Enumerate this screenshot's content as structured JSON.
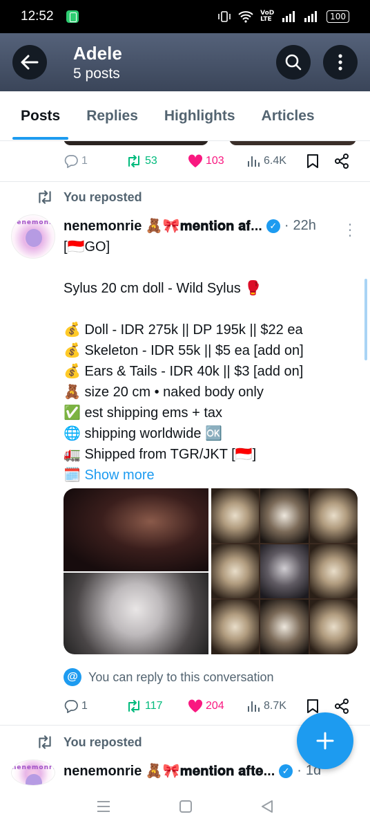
{
  "status_bar": {
    "time": "12:52",
    "battery": "100",
    "network": "VoD LTE"
  },
  "header": {
    "title": "Adele",
    "subtitle": "5 posts"
  },
  "tabs": [
    "Posts",
    "Replies",
    "Highlights",
    "Articles"
  ],
  "tabs_active": "Posts",
  "colors": {
    "accent": "#1d9bf0",
    "like": "#f91880",
    "repost": "#00ba7c"
  },
  "post0": {
    "replies": "1",
    "reposts": "53",
    "likes": "103",
    "views": "6.4K"
  },
  "post1": {
    "repost_label": "You reposted",
    "author": "nenemonrie 🧸🎀𝐦𝐞𝐧𝐭𝐢𝐨𝐧 𝐚𝐟...",
    "time": "22h",
    "avatar_text": "nenemonrie",
    "lines": [
      "[🇮🇩GO]",
      "",
      "Sylus 20 cm doll - Wild Sylus 🥊",
      "",
      "💰 Doll - IDR 275k || DP 195k || $22 ea",
      "💰 Skeleton - IDR 55k || $5 ea [add on]",
      "💰 Ears & Tails - IDR 40k || $3 [add on]",
      "🧸 size 20 cm • naked body only",
      "✅ est shipping ems + tax",
      "🌐 shipping worldwide 🆗",
      "🚛 Shipped from TGR/JKT [🇮🇩]"
    ],
    "show_more_emoji": "🗓️",
    "show_more": "Show more",
    "reply_note": "You can reply to this conversation",
    "replies": "1",
    "reposts": "117",
    "likes": "204",
    "views": "8.7K"
  },
  "post2": {
    "repost_label": "You reposted",
    "author": "nenemonrie 🧸🎀𝐦𝐞𝐧𝐭𝐢𝐨𝐧 𝐚𝐟𝐭𝐞...",
    "time": "1d"
  }
}
